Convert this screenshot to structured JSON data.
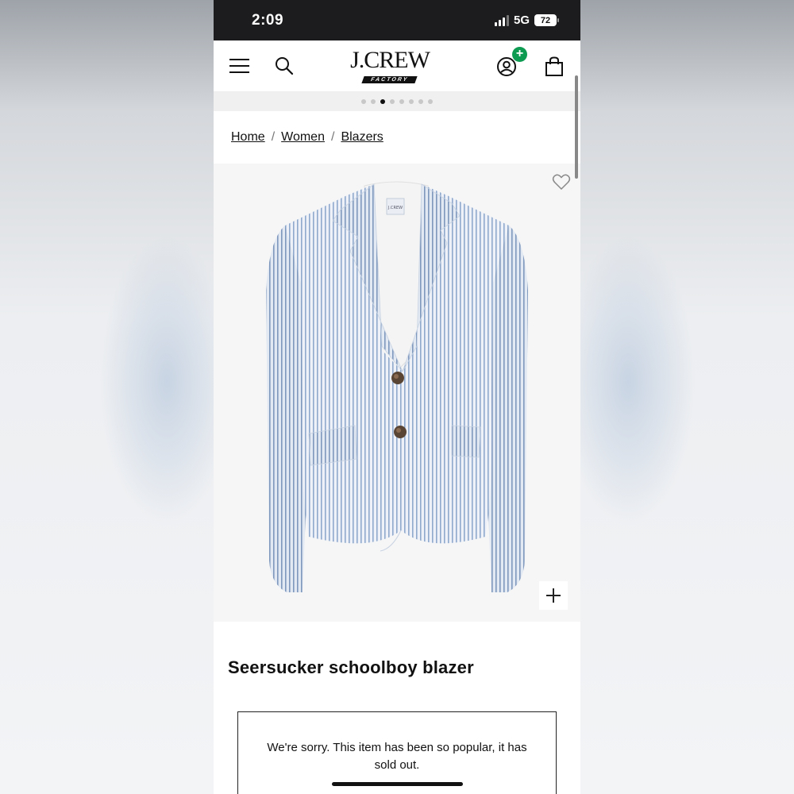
{
  "status_bar": {
    "time": "2:09",
    "network": "5G",
    "battery": "72"
  },
  "header": {
    "logo_main": "J.CREW",
    "logo_sub": "FACTORY",
    "account_badge": "+",
    "icons": [
      "menu-icon",
      "search-icon",
      "account-icon",
      "bag-icon"
    ]
  },
  "carousel": {
    "dot_count": 8,
    "active_index": 2
  },
  "breadcrumb": {
    "items": [
      "Home",
      "Women",
      "Blazers"
    ],
    "separator": "/"
  },
  "product": {
    "title": "Seersucker schoolboy blazer",
    "image_label": "J.CREW"
  },
  "notice": {
    "message": "We're sorry. This item has been so popular, it has sold out."
  },
  "colors": {
    "status_bar_bg": "#1c1c1e",
    "badge_green": "#0d9b52",
    "stripe_blue": "#8fa9cc"
  }
}
